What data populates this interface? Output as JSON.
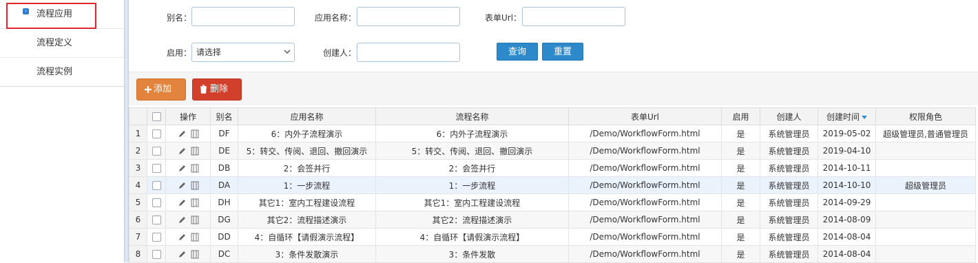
{
  "sidebar": {
    "items": [
      {
        "label": "流程应用",
        "active": true
      },
      {
        "label": "流程定义",
        "active": false
      },
      {
        "label": "流程实例",
        "active": false
      }
    ]
  },
  "filters": {
    "alias_label": "别名：",
    "app_name_label": "应用名称：",
    "form_url_label": "表单Url：",
    "enabled_label": "启用：",
    "enabled_value": "请选择",
    "creator_label": "创建人：",
    "search_button": "查询",
    "reset_button": "重置"
  },
  "toolbar": {
    "add_label": "添加",
    "delete_label": "删除"
  },
  "colors": {
    "accent": "#2d89c9",
    "add": "#e2843d",
    "delete": "#d23f2a",
    "selected_row": "#eaf2fc",
    "highlight_box": "#e3262e"
  },
  "table": {
    "columns": [
      "操作",
      "别名",
      "应用名称",
      "流程名称",
      "表单Url",
      "启用",
      "创建人",
      "创建时间",
      "权限角色"
    ],
    "selected_row_index": 3,
    "rows": [
      {
        "num": "1",
        "alias": "DF",
        "app": "6：内外子流程演示",
        "flow": "6：内外子流程演示",
        "url": "/Demo/WorkflowForm.html",
        "enabled": "是",
        "creator": "系统管理员",
        "created": "2019-05-02",
        "roles": "超级管理员,普通管理员"
      },
      {
        "num": "2",
        "alias": "DE",
        "app": "5：转交、传阅、退回、撤回演示",
        "flow": "5：转交、传阅、退回、撤回演示",
        "url": "/Demo/WorkflowForm.html",
        "enabled": "是",
        "creator": "系统管理员",
        "created": "2019-04-10",
        "roles": ""
      },
      {
        "num": "3",
        "alias": "DB",
        "app": "2：会签并行",
        "flow": "2：会签并行",
        "url": "/Demo/WorkflowForm.html",
        "enabled": "是",
        "creator": "系统管理员",
        "created": "2014-10-11",
        "roles": ""
      },
      {
        "num": "4",
        "alias": "DA",
        "app": "1：一步流程",
        "flow": "1：一步流程",
        "url": "/Demo/WorkflowForm.html",
        "enabled": "是",
        "creator": "系统管理员",
        "created": "2014-10-10",
        "roles": "超级管理员"
      },
      {
        "num": "5",
        "alias": "DH",
        "app": "其它1：室内工程建设流程",
        "flow": "其它1：室内工程建设流程",
        "url": "/Demo/WorkflowForm.html",
        "enabled": "是",
        "creator": "系统管理员",
        "created": "2014-09-29",
        "roles": ""
      },
      {
        "num": "6",
        "alias": "DG",
        "app": "其它2：流程描述演示",
        "flow": "其它2：流程描述演示",
        "url": "/Demo/WorkflowForm.html",
        "enabled": "是",
        "creator": "系统管理员",
        "created": "2014-08-09",
        "roles": ""
      },
      {
        "num": "7",
        "alias": "DD",
        "app": "4：自循环【请假演示流程】",
        "flow": "4：自循环【请假演示流程】",
        "url": "/Demo/WorkflowForm.html",
        "enabled": "是",
        "creator": "系统管理员",
        "created": "2014-08-04",
        "roles": ""
      },
      {
        "num": "8",
        "alias": "DC",
        "app": "3：条件发散演示",
        "flow": "3：条件发散",
        "url": "/Demo/WorkflowForm.html",
        "enabled": "是",
        "creator": "系统管理员",
        "created": "2014-08-04",
        "roles": ""
      }
    ]
  }
}
